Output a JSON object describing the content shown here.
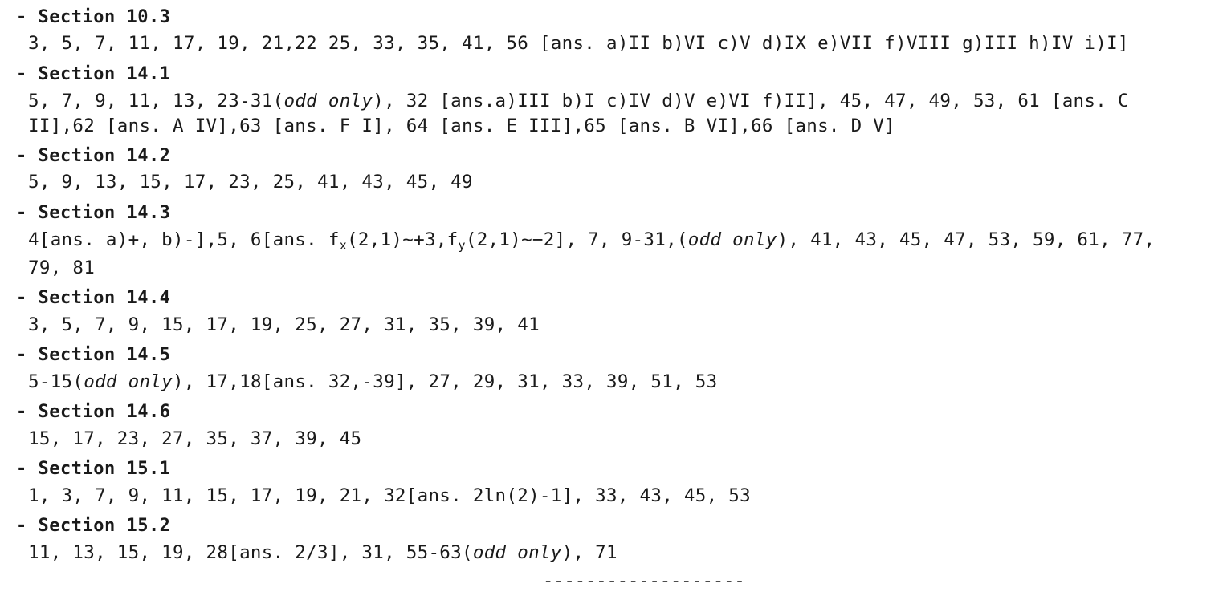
{
  "sections": [
    {
      "heading": "- Section 10.3",
      "lines": [
        "3, 5, 7, 11, 17, 19, 21,22 25, 33, 35, 41, 56 [ans. a)II b)VI c)V d)IX e)VII f)VIII g)III h)IV i)I]"
      ]
    },
    {
      "heading": "- Section 14.1",
      "line1_a": "5, 7, 9, 11, 13, 23-31(",
      "line1_b": "odd only",
      "line1_c": "), 32 [ans.a)III b)I c)IV d)V e)VI f)II], 45, 47, 49, 53, 61 [ans. C",
      "line2": "II],62 [ans. A IV],63 [ans. F I], 64 [ans. E III],65 [ans. B VI],66 [ans. D V]"
    },
    {
      "heading": "- Section 14.2",
      "lines": [
        "5, 9, 13, 15, 17, 23, 25, 41, 43, 45, 49"
      ]
    },
    {
      "heading": "- Section 14.3",
      "p1": "4[ans. a)+, b)-],5, 6[ans. f",
      "sub1": "x",
      "p2": "(2,1)~+3,f",
      "sub2": "y",
      "p3": "(2,1)~−2], 7, 9-31,(",
      "p4": "odd only",
      "p5": "), 41, 43, 45, 47, 53, 59, 61, 77,",
      "line2": "79, 81"
    },
    {
      "heading": "- Section 14.4",
      "lines": [
        "3, 5, 7, 9, 15, 17, 19, 25, 27, 31, 35, 39, 41"
      ]
    },
    {
      "heading": "- Section 14.5",
      "a": "5-15(",
      "b": "odd only",
      "c": "), 17,18[ans. 32,-39], 27, 29, 31, 33, 39, 51, 53"
    },
    {
      "heading": "- Section 14.6",
      "lines": [
        "15, 17, 23, 27, 35, 37, 39, 45"
      ]
    },
    {
      "heading": "- Section 15.1",
      "lines": [
        "1, 3, 7, 9, 11, 15, 17, 19, 21, 32[ans. 2ln(2)-1], 33, 43, 45, 53"
      ]
    },
    {
      "heading": "- Section 15.2",
      "a": "11, 13, 15, 19, 28[ans. 2/3], 31, 55-63(",
      "b": "odd only",
      "c": "), 71"
    }
  ],
  "rule": "-------------------"
}
